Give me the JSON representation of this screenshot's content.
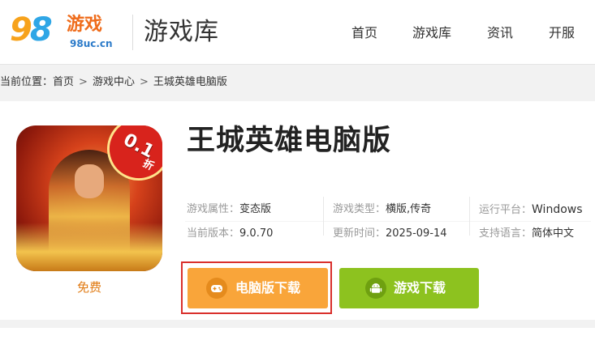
{
  "header": {
    "logo": {
      "digits_9": "9",
      "digits_8": "8",
      "game_word": "游戏",
      "url": "98uc.cn"
    },
    "title": "游戏库",
    "nav": [
      "首页",
      "游戏库",
      "资讯",
      "开服"
    ]
  },
  "breadcrumb": {
    "prefix": "当前位置：",
    "items": [
      "首页",
      "游戏中心",
      "王城英雄电脑版"
    ],
    "separator": ">"
  },
  "game": {
    "icon": {
      "badge_text": "0.1",
      "badge_sub": "折"
    },
    "price": "免费",
    "title": "王城英雄电脑版",
    "info": [
      {
        "key": "游戏属性：",
        "value": "变态版"
      },
      {
        "key": "游戏类型：",
        "value": "横版,传奇"
      },
      {
        "key": "运行平台：",
        "value": "Windows"
      },
      {
        "key": "当前版本：",
        "value": "9.0.70"
      },
      {
        "key": "更新时间：",
        "value": "2025-09-14"
      },
      {
        "key": "支持语言：",
        "value": "简体中文"
      }
    ],
    "buttons": {
      "pc_download": "电脑版下载",
      "game_download": "游戏下载"
    }
  },
  "colors": {
    "pc_button": "#f9a53a",
    "game_button": "#8dc21f",
    "highlight_border": "#d9302c",
    "price": "#e07a12"
  }
}
